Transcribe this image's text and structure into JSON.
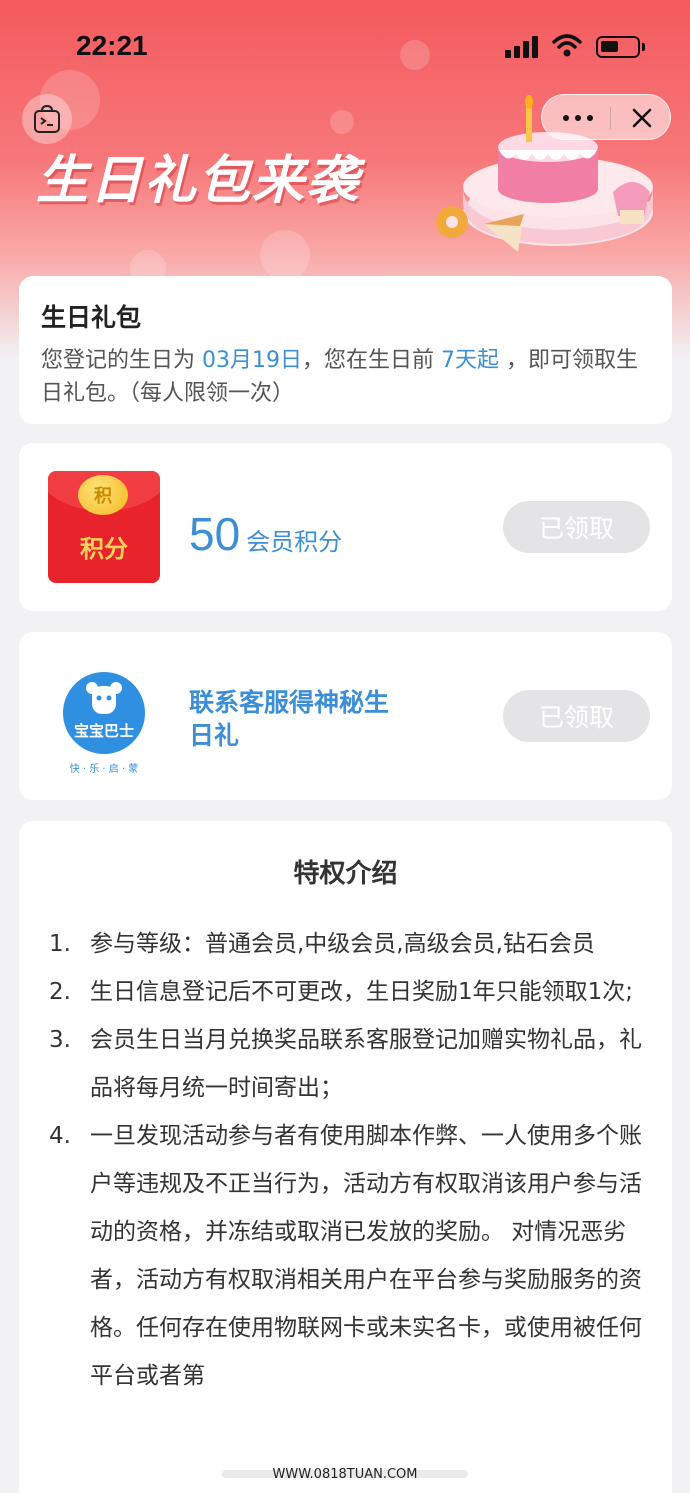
{
  "status_bar": {
    "time": "22:21"
  },
  "header": {
    "banner_title": "生日礼包来袭"
  },
  "info": {
    "title": "生日礼包",
    "desc_prefix": "您登记的生日为 ",
    "birthday": "03月19日",
    "desc_mid": "，您在生日前 ",
    "days": "7天起",
    "desc_suffix": " ，即可领取生日礼包。（每人限领一次）"
  },
  "rewards": [
    {
      "icon_label": "积分",
      "coin_label": "积",
      "amount": "50",
      "unit": "会员积分",
      "button": "已领取"
    },
    {
      "logo_text": "宝宝巴士",
      "logo_sub": "快 · 乐 · 启 · 蒙",
      "label": "联系客服得神秘生日礼",
      "button": "已领取"
    }
  ],
  "privilege": {
    "title": "特权介绍",
    "rules": [
      {
        "num": "1.",
        "text": "参与等级：普通会员,中级会员,高级会员,钻石会员"
      },
      {
        "num": "2.",
        "text": "生日信息登记后不可更改，生日奖励1年只能领取1次;"
      },
      {
        "num": "3.",
        "text": "会员生日当月兑换奖品联系客服登记加赠实物礼品，礼品将每月统一时间寄出；"
      },
      {
        "num": "4.",
        "text": "一旦发现活动参与者有使用脚本作弊、一人使用多个账户等违规及不正当行为，活动方有权取消该用户参与活动的资格，并冻结或取消已发放的奖励。 对情况恶劣者，活动方有权取消相关用户在平台参与奖励服务的资格。任何存在使用物联网卡或未实名卡，或使用被任何平台或者第"
      }
    ]
  },
  "watermark": "WWW.0818TUAN.COM",
  "colors": {
    "accent_blue": "#3c8ed6",
    "hero_red": "#f45a5e",
    "disabled_btn": "#e4e4e6"
  },
  "icons": [
    "bag-terminal-icon",
    "more-icon",
    "close-icon",
    "signal-icon",
    "wifi-icon",
    "battery-icon"
  ]
}
